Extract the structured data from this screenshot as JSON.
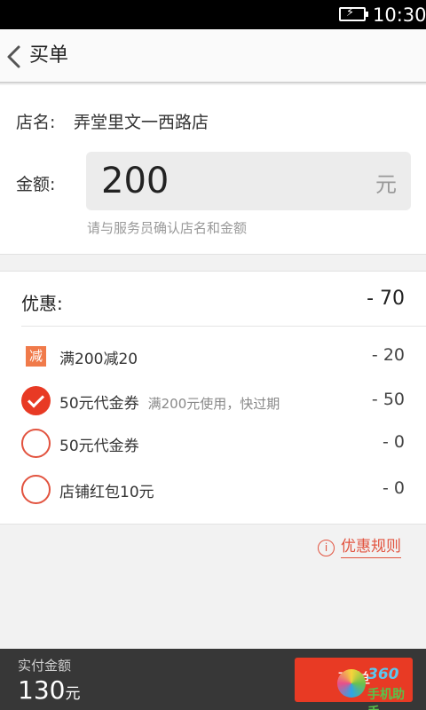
{
  "status_bar": {
    "time": "10:30",
    "battery_icon": "battery-charging-icon"
  },
  "header": {
    "title": "买单",
    "back_icon": "chevron-left-icon"
  },
  "store": {
    "name_label": "店名:",
    "name_value": "弄堂里文一西路店",
    "amount_label": "金额:",
    "amount_value": "200",
    "amount_unit": "元",
    "hint": "请与服务员确认店名和金额"
  },
  "discount": {
    "title": "优惠:",
    "total": "- 70",
    "items": [
      {
        "icon": "jian-badge-icon",
        "badge_text": "减",
        "label": "满200减20",
        "note": "",
        "amount": "- 20",
        "selected": null
      },
      {
        "icon": "radio-checked-icon",
        "label": "50元代金券",
        "note": "满200元使用，快过期",
        "amount": "- 50",
        "selected": true
      },
      {
        "icon": "radio-unchecked-icon",
        "label": "50元代金券",
        "note": "",
        "amount": "- 0",
        "selected": false
      },
      {
        "icon": "radio-unchecked-icon",
        "label": "店铺红包10元",
        "note": "",
        "amount": "- 0",
        "selected": false
      }
    ],
    "rules_link": "优惠规则",
    "rules_icon": "info-icon"
  },
  "footer": {
    "pay_label": "实付金额",
    "pay_value": "130",
    "pay_unit": "元",
    "button_label": "买单"
  },
  "watermark": {
    "top": "360",
    "bottom": "手机助手"
  },
  "colors": {
    "accent": "#e83a24",
    "link": "#e2533f",
    "footer_bg": "#373737"
  }
}
